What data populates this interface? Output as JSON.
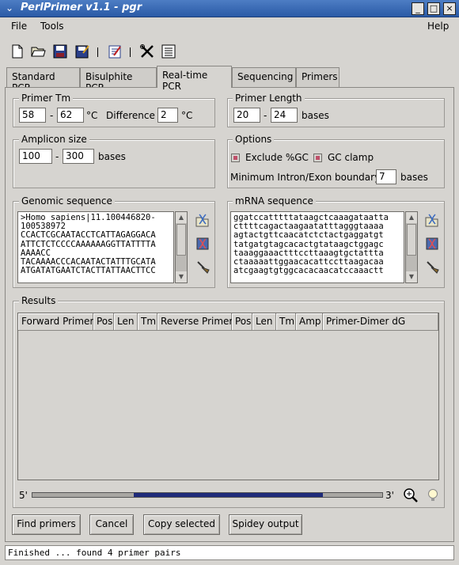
{
  "window": {
    "title": "PerlPrimer v1.1 - pgr",
    "controls": [
      "_",
      "□",
      "×"
    ]
  },
  "menu": {
    "file": "File",
    "tools": "Tools",
    "help": "Help"
  },
  "toolbar": {
    "icons": [
      "new-file-icon",
      "open-folder-icon",
      "save-icon",
      "save-as-icon",
      "notes-icon",
      "tools-icon",
      "list-icon"
    ]
  },
  "tabs": [
    {
      "label": "Standard PCR",
      "active": false
    },
    {
      "label": "Bisulphite PCR",
      "active": false
    },
    {
      "label": "Real-time PCR",
      "active": true
    },
    {
      "label": "Sequencing",
      "active": false
    },
    {
      "label": "Primers",
      "active": false
    }
  ],
  "primer_tm": {
    "title": "Primer Tm",
    "min": "58",
    "dash": "-",
    "max": "62",
    "unit": "°C",
    "difference_label": "Difference",
    "difference": "2",
    "difference_unit": "°C"
  },
  "primer_length": {
    "title": "Primer Length",
    "min": "20",
    "dash": "-",
    "max": "24",
    "unit": "bases"
  },
  "amplicon_size": {
    "title": "Amplicon size",
    "min": "100",
    "dash": "-",
    "max": "300",
    "unit": "bases"
  },
  "options": {
    "title": "Options",
    "exclude_gc_label": "Exclude %GC",
    "exclude_gc": true,
    "gc_clamp_label": "GC clamp",
    "gc_clamp": true,
    "intron_label": "Minimum Intron/Exon boundary:",
    "intron_value": "7",
    "intron_unit": "bases"
  },
  "genomic_sequence": {
    "title": "Genomic sequence",
    "text": ">Homo sapiens|11.100446820-\n100538972\nCCACTCGCAATACCTCATTAGAGGACA\nATTCTCTCCCCAAAAAAGGTTATTTTA\nAAAACC\nTACAAAACCCACAATACTATTTGCATA\nATGATATGAATCTACTTATTAACTTCC"
  },
  "mrna_sequence": {
    "title": "mRNA sequence",
    "text": "ggatccatttttataagctcaaagataatta\ncttttcagactaagaatatttagggtaaaa\nagtactgttcaacatctctactgaggatgt\ntatgatgtagcacactgtataagctggagc\ntaaaggaaactttccttaaagtgctattta\nctaaaaattggaacacattccttaagacaa\natcgaagtgtggcacacaacatccaaactt"
  },
  "results": {
    "title": "Results",
    "columns": [
      "Forward Primer",
      "Pos",
      "Len",
      "Tm",
      "Reverse Primer",
      "Pos",
      "Len",
      "Tm",
      "Amp",
      "Primer-Dimer dG"
    ],
    "rows": [],
    "position_5": "5'",
    "position_3": "3'",
    "amplicon_span": {
      "start_fraction": 0.29,
      "end_fraction": 0.83
    }
  },
  "buttons": {
    "find": "Find primers",
    "cancel": "Cancel",
    "copy": "Copy selected",
    "spidey": "Spidey output"
  },
  "status": "Finished ... found 4 primer pairs",
  "colors": {
    "titlebar": "#2a5aa6",
    "checkbox_checked": "#c0506a",
    "amplicon_bar": "#1e2a7a"
  }
}
